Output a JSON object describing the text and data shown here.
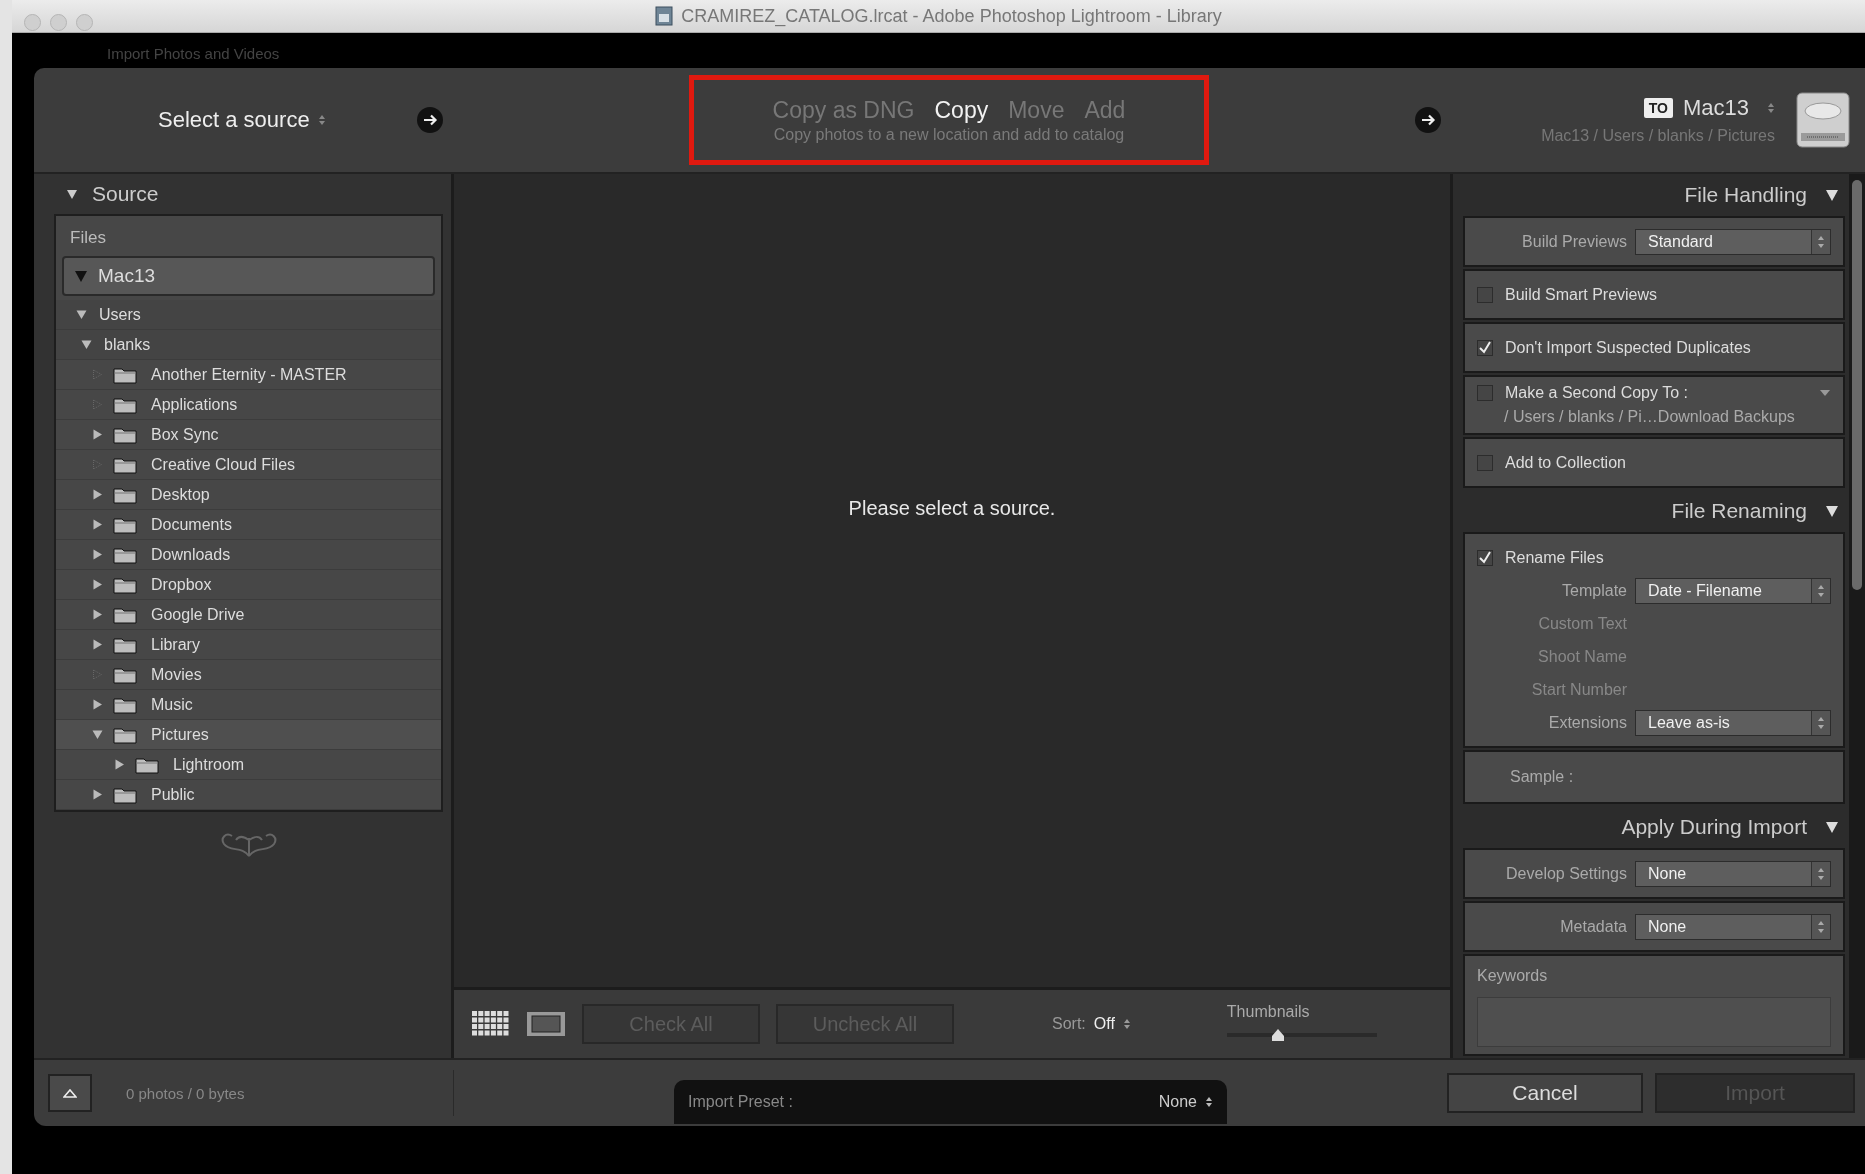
{
  "window": {
    "title": "CRAMIREZ_CATALOG.lrcat - Adobe Photoshop Lightroom - Library"
  },
  "background_title": "Import Photos and Videos",
  "header": {
    "source_label": "Select a source",
    "modes": [
      {
        "label": "Copy as DNG",
        "selected": false
      },
      {
        "label": "Copy",
        "selected": true
      },
      {
        "label": "Move",
        "selected": false
      },
      {
        "label": "Add",
        "selected": false
      }
    ],
    "mode_description": "Copy photos to a new location and add to catalog",
    "destination": {
      "badge": "TO",
      "name": "Mac13",
      "path": "Mac13 / Users / blanks / Pictures"
    }
  },
  "source_panel": {
    "title": "Source",
    "files_label": "Files",
    "tree": [
      {
        "name": "Mac13",
        "expandable": true,
        "expanded": true,
        "children": [
          {
            "name": "Users",
            "expandable": true,
            "expanded": true,
            "children": [
              {
                "name": "blanks",
                "expandable": true,
                "expanded": true,
                "children": [
                  {
                    "name": "Another Eternity - MASTER",
                    "expandable": false
                  },
                  {
                    "name": "Applications",
                    "expandable": false
                  },
                  {
                    "name": "Box Sync",
                    "expandable": true,
                    "expanded": false
                  },
                  {
                    "name": "Creative Cloud Files",
                    "expandable": false
                  },
                  {
                    "name": "Desktop",
                    "expandable": true,
                    "expanded": false
                  },
                  {
                    "name": "Documents",
                    "expandable": true,
                    "expanded": false
                  },
                  {
                    "name": "Downloads",
                    "expandable": true,
                    "expanded": false
                  },
                  {
                    "name": "Dropbox",
                    "expandable": true,
                    "expanded": false
                  },
                  {
                    "name": "Google Drive",
                    "expandable": true,
                    "expanded": false
                  },
                  {
                    "name": "Library",
                    "expandable": true,
                    "expanded": false
                  },
                  {
                    "name": "Movies",
                    "expandable": false
                  },
                  {
                    "name": "Music",
                    "expandable": true,
                    "expanded": false
                  },
                  {
                    "name": "Pictures",
                    "expandable": true,
                    "expanded": true,
                    "children": [
                      {
                        "name": "Lightroom",
                        "expandable": true,
                        "expanded": false
                      }
                    ]
                  },
                  {
                    "name": "Public",
                    "expandable": true,
                    "expanded": false
                  }
                ]
              }
            ]
          }
        ]
      }
    ]
  },
  "preview": {
    "message": "Please select a source."
  },
  "toolbar": {
    "check_all": {
      "label": "Check All",
      "disabled": true
    },
    "uncheck_all": {
      "label": "Uncheck All",
      "disabled": true
    },
    "sort_label": "Sort:",
    "sort_value": "Off",
    "thumbnails_label": "Thumbnails",
    "thumbnails": {
      "level": 0.34
    }
  },
  "right_panel": {
    "sections": [
      {
        "title": "File Handling",
        "boxes": [
          {
            "items": [
              {
                "kind": "select",
                "label": "Build Previews",
                "value": "Standard"
              }
            ]
          },
          {
            "items": [
              {
                "kind": "checkbox",
                "label": "Build Smart Previews",
                "checked": false
              }
            ]
          },
          {
            "items": [
              {
                "kind": "checkbox",
                "label": "Don't Import Suspected Duplicates",
                "checked": true
              }
            ]
          },
          {
            "items": [
              {
                "kind": "checkbox",
                "label": "Make a Second Copy To :",
                "checked": false,
                "path": "/ Users / blanks / Pi…Download Backups"
              }
            ]
          },
          {
            "items": [
              {
                "kind": "checkbox",
                "label": "Add to Collection",
                "checked": false
              }
            ]
          }
        ]
      },
      {
        "title": "File Renaming",
        "boxes": [
          {
            "items": [
              {
                "kind": "checkbox",
                "label": "Rename Files",
                "checked": true
              },
              {
                "kind": "select",
                "label": "Template",
                "value": "Date - Filename"
              },
              {
                "kind": "label",
                "label": "Custom Text"
              },
              {
                "kind": "label",
                "label": "Shoot Name"
              },
              {
                "kind": "label",
                "label": "Start Number"
              },
              {
                "kind": "select",
                "label": "Extensions",
                "value": "Leave as-is"
              }
            ]
          },
          {
            "items": [
              {
                "kind": "sample",
                "label": "Sample :"
              }
            ]
          }
        ]
      },
      {
        "title": "Apply During Import",
        "boxes": [
          {
            "items": [
              {
                "kind": "select",
                "label": "Develop Settings",
                "value": "None"
              }
            ]
          },
          {
            "items": [
              {
                "kind": "select",
                "label": "Metadata",
                "value": "None"
              }
            ]
          },
          {
            "items": [
              {
                "kind": "keywords",
                "label": "Keywords"
              }
            ]
          }
        ]
      }
    ]
  },
  "bottom_bar": {
    "status": "0 photos / 0 bytes",
    "preset_label": "Import Preset :",
    "preset_value": "None",
    "cancel": {
      "label": "Cancel",
      "disabled": false
    },
    "import": {
      "label": "Import",
      "disabled": true
    }
  }
}
